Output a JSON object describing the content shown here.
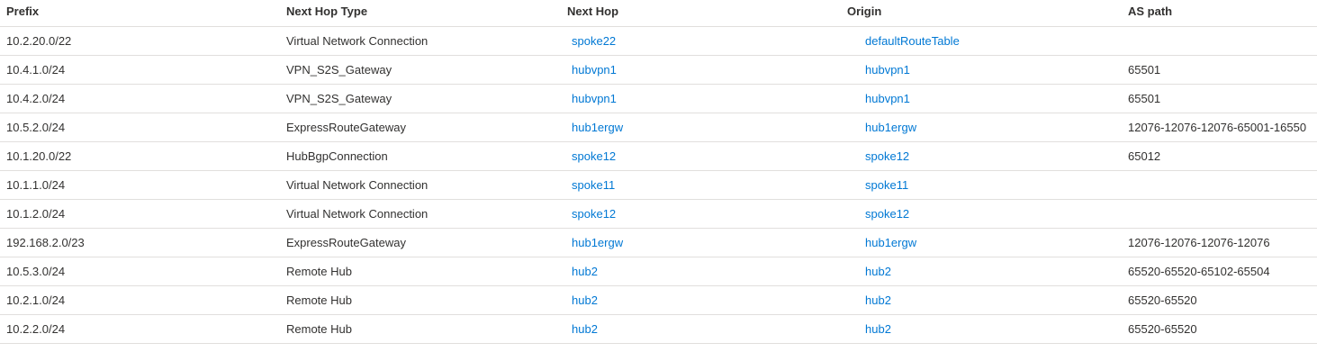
{
  "table": {
    "columns": {
      "prefix": "Prefix",
      "next_hop_type": "Next Hop Type",
      "next_hop": "Next Hop",
      "origin": "Origin",
      "as_path": "AS path"
    },
    "rows": [
      {
        "prefix": "10.2.20.0/22",
        "next_hop_type": "Virtual Network Connection",
        "next_hop": "spoke22",
        "origin": "defaultRouteTable",
        "as_path": ""
      },
      {
        "prefix": "10.4.1.0/24",
        "next_hop_type": "VPN_S2S_Gateway",
        "next_hop": "hubvpn1",
        "origin": "hubvpn1",
        "as_path": "65501"
      },
      {
        "prefix": "10.4.2.0/24",
        "next_hop_type": "VPN_S2S_Gateway",
        "next_hop": "hubvpn1",
        "origin": "hubvpn1",
        "as_path": "65501"
      },
      {
        "prefix": "10.5.2.0/24",
        "next_hop_type": "ExpressRouteGateway",
        "next_hop": "hub1ergw",
        "origin": "hub1ergw",
        "as_path": "12076-12076-12076-65001-16550"
      },
      {
        "prefix": "10.1.20.0/22",
        "next_hop_type": "HubBgpConnection",
        "next_hop": "spoke12",
        "origin": "spoke12",
        "as_path": "65012"
      },
      {
        "prefix": "10.1.1.0/24",
        "next_hop_type": "Virtual Network Connection",
        "next_hop": "spoke11",
        "origin": "spoke11",
        "as_path": ""
      },
      {
        "prefix": "10.1.2.0/24",
        "next_hop_type": "Virtual Network Connection",
        "next_hop": "spoke12",
        "origin": "spoke12",
        "as_path": ""
      },
      {
        "prefix": "192.168.2.0/23",
        "next_hop_type": "ExpressRouteGateway",
        "next_hop": "hub1ergw",
        "origin": "hub1ergw",
        "as_path": "12076-12076-12076-12076"
      },
      {
        "prefix": "10.5.3.0/24",
        "next_hop_type": "Remote Hub",
        "next_hop": "hub2",
        "origin": "hub2",
        "as_path": "65520-65520-65102-65504"
      },
      {
        "prefix": "10.2.1.0/24",
        "next_hop_type": "Remote Hub",
        "next_hop": "hub2",
        "origin": "hub2",
        "as_path": "65520-65520"
      },
      {
        "prefix": "10.2.2.0/24",
        "next_hop_type": "Remote Hub",
        "next_hop": "hub2",
        "origin": "hub2",
        "as_path": "65520-65520"
      }
    ]
  },
  "colors": {
    "link": "#0078d4",
    "text": "#323130",
    "divider": "#e1dfdd"
  }
}
